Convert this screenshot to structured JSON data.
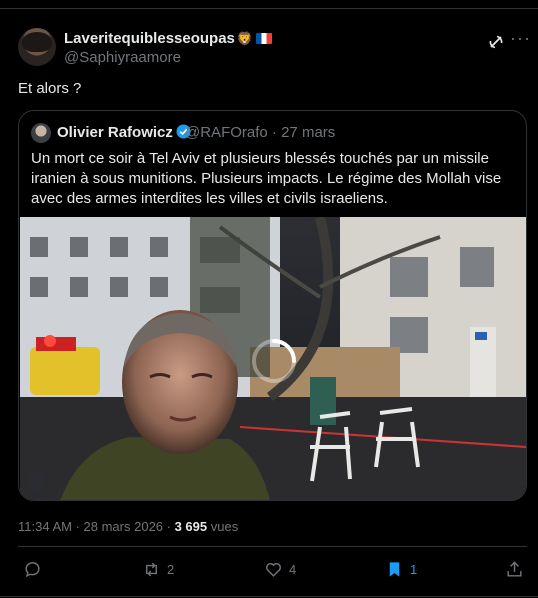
{
  "tweet": {
    "author_name": "Laveritequiblesseoupas",
    "author_emoji": "🦁",
    "author_handle": "@Saphiyraamore",
    "text": "Et alors ?"
  },
  "quoted": {
    "author_name": "Olivier Rafowicz",
    "author_handle": "@RAFOrafo",
    "date": "27 mars",
    "text": "Un mort ce soir à Tel Aviv et plusieurs blessés touchés par un missile iranien à sous munitions. Plusieurs impacts. Le régime des Mollah vise avec des armes interdites les villes et civils israeliens."
  },
  "meta": {
    "time": "11:34 AM",
    "date": "28 mars 2026",
    "views_count": "3 695",
    "views_label": "vues"
  },
  "actions": {
    "replies": "",
    "reposts": "2",
    "likes": "4",
    "bookmarks": "1"
  },
  "colors": {
    "background": "#000000",
    "text": "#e7e9ea",
    "muted": "#71767b",
    "border": "#2f3336",
    "accent_blue": "#1d9bf0"
  }
}
